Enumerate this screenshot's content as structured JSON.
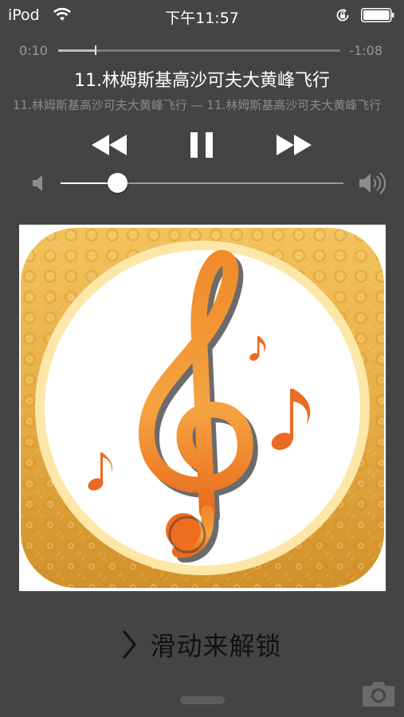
{
  "status_bar": {
    "device": "iPod",
    "time": "下午11:57",
    "wifi_icon": "wifi-icon",
    "lock_icon": "rotation-lock-icon",
    "battery_icon": "battery-full-icon"
  },
  "player": {
    "elapsed": "0:10",
    "remaining": "-1:08",
    "progress_fraction": 0.13,
    "title": "11.林姆斯基高沙可夫大黄峰飞行",
    "subtitle": "11.林姆斯基高沙可夫大黄峰飞行 — 11.林姆斯基高沙可夫大黄峰飞行",
    "controls": {
      "previous_icon": "rewind-icon",
      "pause_icon": "pause-icon",
      "next_icon": "fast-forward-icon"
    },
    "volume": {
      "level_fraction": 0.2,
      "low_icon": "volume-low-icon",
      "high_icon": "volume-high-icon"
    },
    "artwork_icon": "treble-clef-music-icon"
  },
  "lock_screen": {
    "unlock_text": "滑动来解锁",
    "camera_icon": "camera-icon"
  },
  "colors": {
    "background": "#444444",
    "text": "#ffffff",
    "secondary_text": "#9a9a9a",
    "artwork_gold": "#e2a93f",
    "clef_orange": "#ef7d1f"
  }
}
